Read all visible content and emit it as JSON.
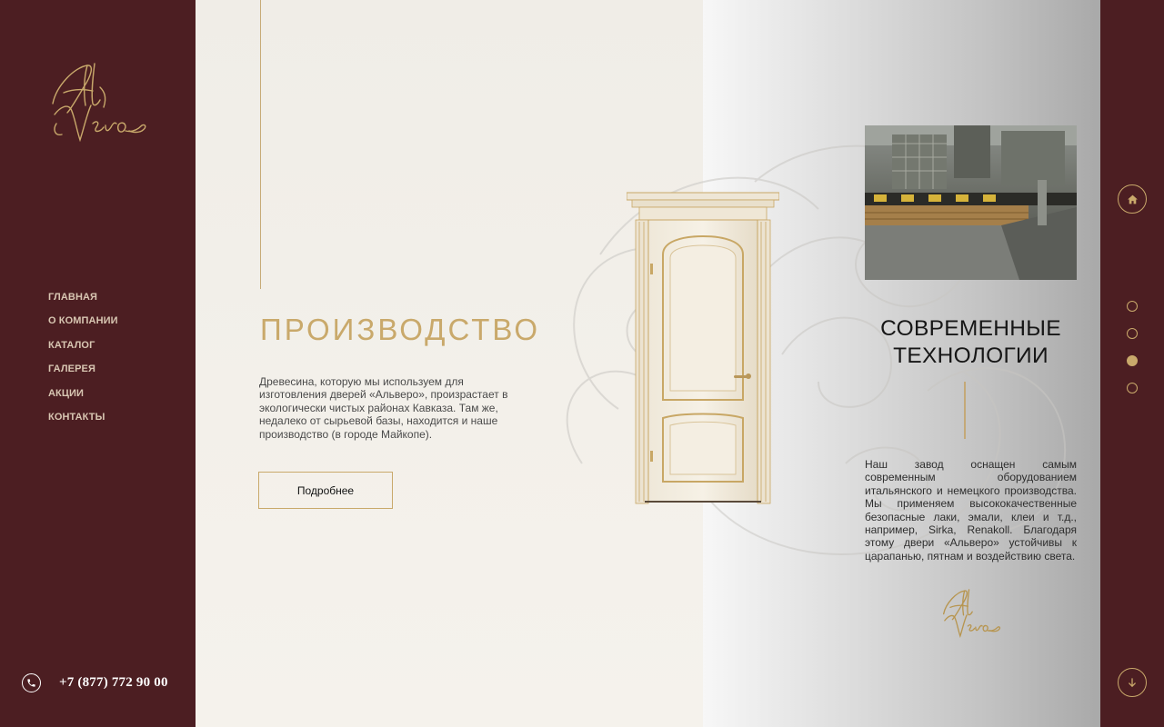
{
  "brand": {
    "logo_text": "Al Vero"
  },
  "nav": {
    "items": [
      {
        "label": "ГЛАВНАЯ"
      },
      {
        "label": "О КОМПАНИИ"
      },
      {
        "label": "КАТАЛОГ"
      },
      {
        "label": "ГАЛЕРЕЯ"
      },
      {
        "label": "АКЦИИ"
      },
      {
        "label": "КОНТАКТЫ"
      }
    ]
  },
  "contact": {
    "phone": "+7 (877) 772 90 00",
    "icon": "phone-icon"
  },
  "production": {
    "title": "ПРОИЗВОДСТВО",
    "text": "Древесина, которую мы используем для изготовления дверей «Альверо», произрастает в экологически чистых районах Кавказа. Там же, недалеко от сырьевой базы, находится и наше производство (в городе Майкопе).",
    "button_label": "Подробнее"
  },
  "technologies": {
    "title_line1": "СОВРЕМЕННЫЕ",
    "title_line2": "ТЕХНОЛОГИИ",
    "text": "Наш завод оснащен самым современным оборудованием итальянского и немецкого производства. Мы применяем высококачественные безопасные лаки, эмали, клеи и т.д., например, Sirka, Renakoll. Благодаря этому двери «Альверо» устойчивы к царапанью, пятнам и воздействию света."
  },
  "rail": {
    "home_icon": "home-icon",
    "down_icon": "arrow-down-icon",
    "slides": [
      {
        "active": false
      },
      {
        "active": false
      },
      {
        "active": true
      },
      {
        "active": false
      }
    ]
  },
  "colors": {
    "burgundy": "#4c1e22",
    "gold": "#c9a96b",
    "cream": "#f1ede6"
  }
}
